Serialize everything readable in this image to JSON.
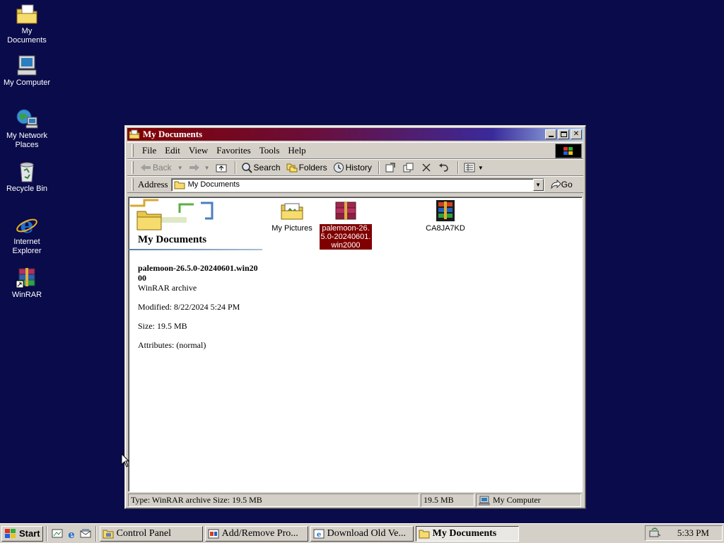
{
  "desktop": {
    "icons": [
      {
        "label": "My Documents",
        "icon": "my-documents-icon"
      },
      {
        "label": "My Computer",
        "icon": "my-computer-icon"
      },
      {
        "label": "My Network Places",
        "icon": "network-places-icon"
      },
      {
        "label": "Recycle Bin",
        "icon": "recycle-bin-icon"
      },
      {
        "label": "Internet Explorer",
        "icon": "internet-explorer-icon"
      },
      {
        "label": "WinRAR",
        "icon": "winrar-icon"
      }
    ]
  },
  "window": {
    "title": "My Documents",
    "menu": [
      "File",
      "Edit",
      "View",
      "Favorites",
      "Tools",
      "Help"
    ],
    "toolbar": {
      "back": "Back",
      "search": "Search",
      "folders": "Folders",
      "history": "History"
    },
    "address": {
      "label": "Address",
      "value": "My Documents",
      "go": "Go"
    },
    "sidebar": {
      "title": "My Documents",
      "selected_name": "palemoon-26.5.0-20240601.win2000",
      "selected_type": "WinRAR archive",
      "modified": "Modified: 8/22/2024 5:24 PM",
      "size": "Size: 19.5 MB",
      "attributes": "Attributes: (normal)"
    },
    "files": [
      {
        "name": "My Pictures",
        "icon": "pictures-folder-icon",
        "selected": false
      },
      {
        "name": "palemoon-26.5.0-20240601.win2000",
        "icon": "rar-archive-icon",
        "selected": true
      },
      {
        "name": "CA8JA7KD",
        "icon": "winrar-installer-icon",
        "selected": false
      }
    ],
    "status": {
      "info": "Type: WinRAR archive Size: 19.5 MB",
      "size": "19.5 MB",
      "zone": "My Computer"
    }
  },
  "taskbar": {
    "start": "Start",
    "tasks": [
      {
        "label": "Control Panel",
        "active": false
      },
      {
        "label": "Add/Remove Pro...",
        "active": false
      },
      {
        "label": "Download Old Ve...",
        "active": false
      },
      {
        "label": "My Documents",
        "active": true
      }
    ],
    "clock": "5:33 PM"
  },
  "colors": {
    "desktop": "#0a0b4b",
    "selection": "#800000",
    "face": "#d4d0c8"
  }
}
